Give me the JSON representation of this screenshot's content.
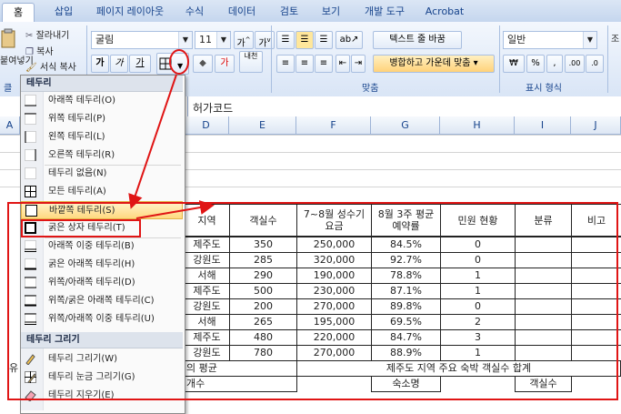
{
  "ribbon_tabs": [
    "홈",
    "삽입",
    "페이지 레이아웃",
    "수식",
    "데이터",
    "검토",
    "보기",
    "개발 도구",
    "Acrobat"
  ],
  "clipboard": {
    "cut": "잘라내기",
    "copy": "복사",
    "format_painter": "서식 복사",
    "paste": "붙여넣기",
    "group_label": "클"
  },
  "font": {
    "name": "굴림",
    "size": "11",
    "bold": "가",
    "italic": "가",
    "underline": "가"
  },
  "alignment": {
    "wrap_text": "텍스트 줄 바꿈",
    "merge_center": "병합하고 가운데 맞춤",
    "group_label": "맞춤"
  },
  "number": {
    "format": "일반",
    "currency": "₩",
    "percent": "%",
    "comma": ",",
    "group_label": "표시 형식"
  },
  "right_cut_label": "조",
  "formula_bar": {
    "value": "허가코드"
  },
  "columns": [
    "A",
    "D",
    "E",
    "F",
    "G",
    "H",
    "I",
    "J"
  ],
  "menu": {
    "header": "테두리",
    "items": [
      {
        "label": "아래쪽 테두리(O)",
        "icon": "border-bottom-icon"
      },
      {
        "label": "위쪽 테두리(P)",
        "icon": "border-top-icon"
      },
      {
        "label": "왼쪽 테두리(L)",
        "icon": "border-left-icon"
      },
      {
        "label": "오른쪽 테두리(R)",
        "icon": "border-right-icon"
      },
      {
        "label": "테두리 없음(N)",
        "icon": "border-none-icon"
      },
      {
        "label": "모든 테두리(A)",
        "icon": "border-all-icon"
      },
      {
        "label": "바깥쪽 테두리(S)",
        "icon": "border-outside-icon"
      },
      {
        "label": "굵은 상자 테두리(T)",
        "icon": "border-thick-box-icon"
      },
      {
        "label": "아래쪽 이중 테두리(B)",
        "icon": "border-double-bottom-icon"
      },
      {
        "label": "굵은 아래쪽 테두리(H)",
        "icon": "border-thick-bottom-icon"
      },
      {
        "label": "위쪽/아래쪽 테두리(D)",
        "icon": "border-top-bottom-icon"
      },
      {
        "label": "위쪽/굵은 아래쪽 테두리(C)",
        "icon": "border-top-thick-bottom-icon"
      },
      {
        "label": "위쪽/아래쪽 이중 테두리(U)",
        "icon": "border-top-double-bottom-icon"
      }
    ],
    "draw_header": "테두리 그리기",
    "draw_items": [
      {
        "label": "테두리 그리기(W)",
        "icon": "pencil-icon"
      },
      {
        "label": "테두리 눈금 그리기(G)",
        "icon": "grid-pencil-icon"
      },
      {
        "label": "테두리 지우기(E)",
        "icon": "eraser-icon"
      }
    ]
  },
  "table": {
    "headers": [
      "지역",
      "객실수",
      "7~8월 성수기요금",
      "8월 3주 평균 예약률",
      "민원 현황",
      "분류",
      "비고"
    ],
    "rows": [
      [
        "제주도",
        "350",
        "250,000",
        "84.5%",
        "0"
      ],
      [
        "강원도",
        "285",
        "320,000",
        "92.7%",
        "0"
      ],
      [
        "서해",
        "290",
        "190,000",
        "78.8%",
        "1"
      ],
      [
        "제주도",
        "500",
        "230,000",
        "87.1%",
        "1"
      ],
      [
        "강원도",
        "200",
        "270,000",
        "89.8%",
        "0"
      ],
      [
        "서해",
        "265",
        "195,000",
        "69.5%",
        "2"
      ],
      [
        "제주도",
        "480",
        "220,000",
        "84.7%",
        "3"
      ],
      [
        "강원도",
        "780",
        "270,000",
        "88.9%",
        "1"
      ]
    ],
    "footer1_left": "의 평균",
    "footer1_right": "제주도 지역 주요 숙박 객실수 합계",
    "footer2_left": "개수",
    "footer2_mid": "숙소명",
    "footer2_right": "객실수",
    "row_stub_a": "유"
  },
  "annotation_color": "#e01515"
}
